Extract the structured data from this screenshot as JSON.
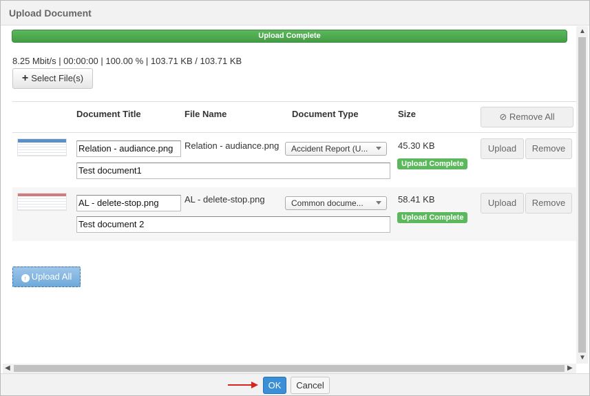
{
  "dialog": {
    "title": "Upload Document",
    "progress_label": "Upload Complete",
    "stats": "8.25 Mbit/s | 00:00:00 | 100.00 % | 103.71 KB / 103.71 KB",
    "select_files_label": "Select File(s)",
    "progress_fraction": 1.0
  },
  "table": {
    "headers": {
      "title": "Document Title",
      "file_name": "File Name",
      "type": "Document Type",
      "size": "Size"
    },
    "remove_all_label": "Remove All",
    "rows": [
      {
        "title": "Relation - audiance.png",
        "file_name": "Relation - audiance.png",
        "type": "Accident Report (U...",
        "size": "45.30 KB",
        "status": "Upload Complete",
        "description": "Test document1",
        "upload_label": "Upload",
        "remove_label": "Remove"
      },
      {
        "title": "AL - delete-stop.png",
        "file_name": "AL - delete-stop.png",
        "type": "Common docume...",
        "size": "58.41 KB",
        "status": "Upload Complete",
        "description": "Test document 2",
        "upload_label": "Upload",
        "remove_label": "Remove"
      }
    ]
  },
  "upload_all_label": "Upload All",
  "footer": {
    "ok_label": "OK",
    "cancel_label": "Cancel"
  },
  "colors": {
    "progress": "#5cb85c",
    "badge": "#5cb85c",
    "primary": "#3a8fd6",
    "arrow": "#d9231e"
  }
}
